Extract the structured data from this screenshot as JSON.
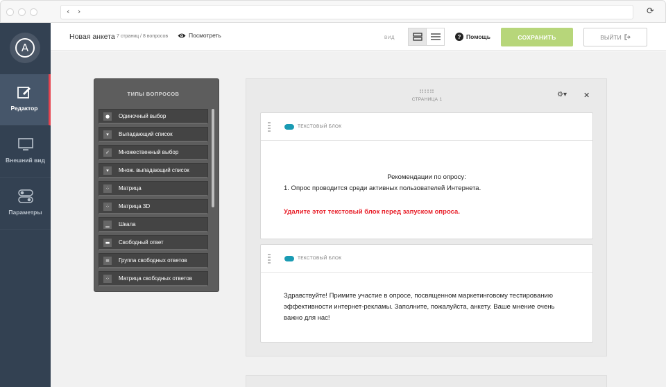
{
  "sidebar": {
    "logo": "A",
    "items": [
      {
        "label": "Редактор",
        "icon": "edit-icon"
      },
      {
        "label": "Внешний вид",
        "icon": "monitor-icon"
      },
      {
        "label": "Параметры",
        "icon": "toggle-settings-icon"
      }
    ]
  },
  "topbar": {
    "title": "Новая анкета",
    "meta": "7 страниц / 8 вопросов",
    "preview_label": "Посмотреть",
    "view_label": "ВИД",
    "help_label": "Помощь",
    "save_label": "СОХРАНИТЬ",
    "exit_label": "ВЫЙТИ"
  },
  "question_types": {
    "title": "ТИПЫ ВОПРОСОВ",
    "items": [
      {
        "label": "Одиночный выбор",
        "icon": "radio-icon"
      },
      {
        "label": "Выпадающий список",
        "icon": "dropdown-icon"
      },
      {
        "label": "Множественный выбор",
        "icon": "checkbox-icon"
      },
      {
        "label": "Множ. выпадающий список",
        "icon": "dropdown-icon"
      },
      {
        "label": "Матрица",
        "icon": "matrix-icon"
      },
      {
        "label": "Матрица 3D",
        "icon": "matrix-icon"
      },
      {
        "label": "Шкала",
        "icon": "scale-icon"
      },
      {
        "label": "Свободный ответ",
        "icon": "text-field-icon"
      },
      {
        "label": "Группа свободных ответов",
        "icon": "text-group-icon"
      },
      {
        "label": "Матрица свободных ответов",
        "icon": "matrix-icon"
      }
    ]
  },
  "page": {
    "label": "СТРАНИЦА 1",
    "blocks": [
      {
        "type_label": "ТЕКСТОВЫЙ БЛОК",
        "heading": "Рекомендации по опросу:",
        "line1": "1. Опрос проводится среди активных пользователей Интернета.",
        "warning": "Удалите этот текстовый блок перед запуском опроса."
      },
      {
        "type_label": "ТЕКСТОВЫЙ БЛОК",
        "line1": "Здравствуйте! Примите участие в опросе, посвященном маркетинговому тестированию",
        "line2": "эффективности интернет-рекламы. Заполните, пожалуйста, анкету. Ваше мнение очень",
        "line3": "важно для нас!"
      }
    ]
  },
  "colors": {
    "sidebar": "#334152",
    "active_marker": "#e6434f",
    "save": "#b7d67a",
    "toggle": "#1a9bb3",
    "warning": "#e8202a"
  }
}
